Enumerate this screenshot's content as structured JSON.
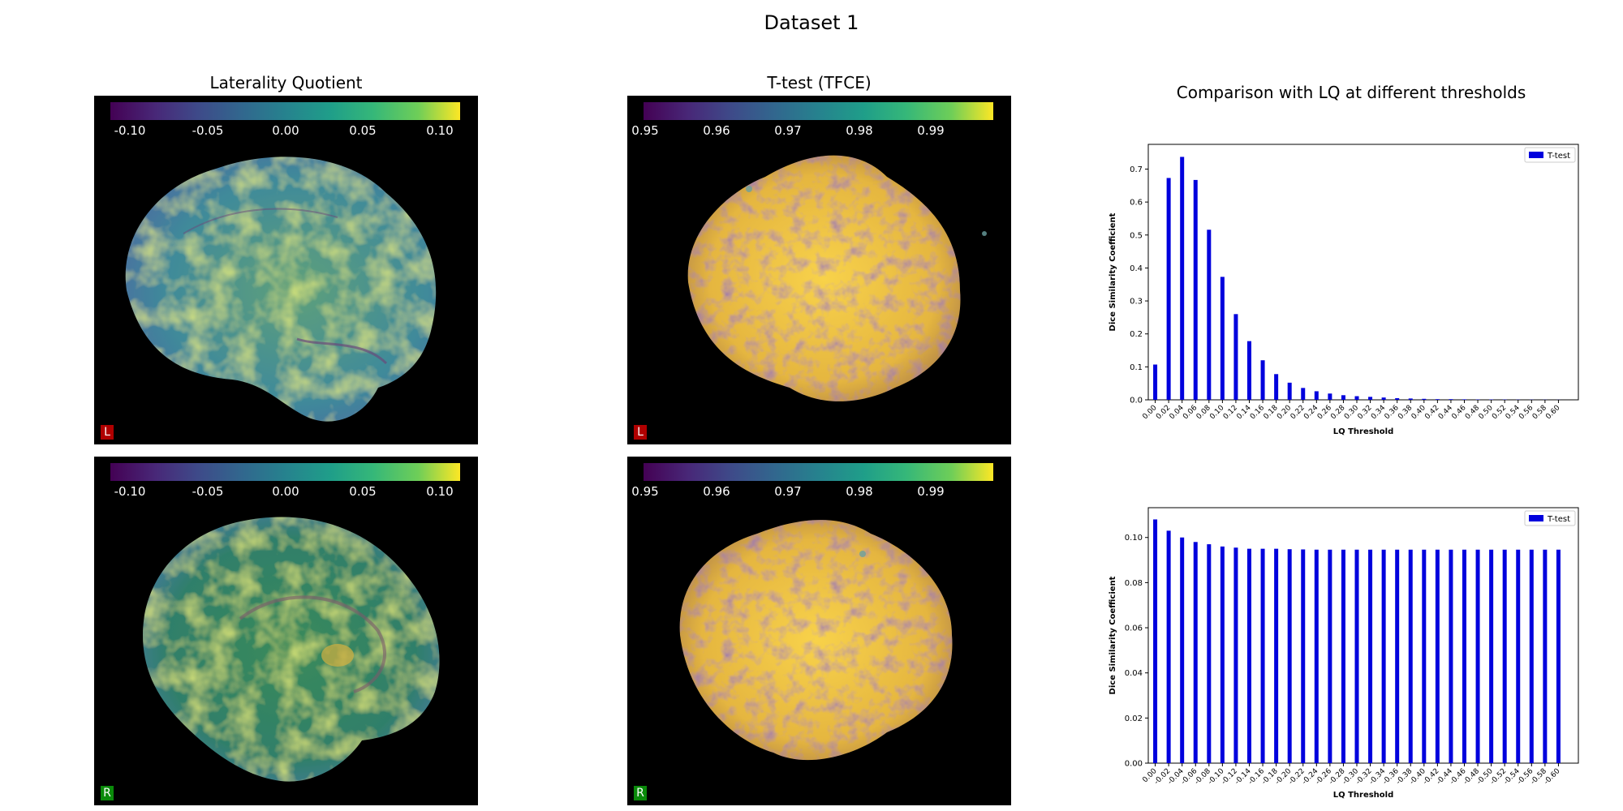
{
  "suptitle": "Dataset 1",
  "columns": {
    "lq_title": "Laterality Quotient",
    "ttest_title": "T-test (TFCE)",
    "compare_title": "Comparison with LQ at different thresholds"
  },
  "colorbars": {
    "lq": {
      "ticks": [
        "-0.10",
        "-0.05",
        "0.00",
        "0.05",
        "0.10"
      ],
      "colormap": "viridis"
    },
    "ttest": {
      "ticks": [
        "0.95",
        "0.96",
        "0.97",
        "0.98",
        "0.99"
      ],
      "colormap": "viridis"
    }
  },
  "brain_views": [
    {
      "row": "left-lateral",
      "hemisphere_label": "L",
      "badge_color": "#b00000"
    },
    {
      "row": "right-medial",
      "hemisphere_label": "R",
      "badge_color": "#0a8a0a"
    }
  ],
  "chart_data": [
    {
      "type": "bar",
      "title": "",
      "xlabel": "LQ Threshold",
      "ylabel": "Dice Similarity Coefficient",
      "categories": [
        "0.00",
        "0.02",
        "0.04",
        "0.06",
        "0.08",
        "0.10",
        "0.12",
        "0.14",
        "0.16",
        "0.18",
        "0.20",
        "0.22",
        "0.24",
        "0.26",
        "0.28",
        "0.30",
        "0.32",
        "0.34",
        "0.36",
        "0.38",
        "0.40",
        "0.42",
        "0.44",
        "0.46",
        "0.48",
        "0.50",
        "0.52",
        "0.54",
        "0.56",
        "0.58",
        "0.60"
      ],
      "series": [
        {
          "name": "T-test",
          "color": "#0000dd",
          "values": [
            0.107,
            0.673,
            0.737,
            0.667,
            0.516,
            0.373,
            0.26,
            0.178,
            0.12,
            0.078,
            0.052,
            0.036,
            0.026,
            0.019,
            0.014,
            0.011,
            0.009,
            0.007,
            0.005,
            0.004,
            0.003,
            0.002,
            0.002,
            0.0015,
            0.001,
            0.001,
            0.0008,
            0.0006,
            0.0005,
            0.0004,
            0.0003
          ]
        }
      ],
      "ylim": [
        0,
        0.775
      ],
      "yticks": [
        "0.0",
        "0.1",
        "0.2",
        "0.3",
        "0.4",
        "0.5",
        "0.6",
        "0.7"
      ],
      "legend": "top-right",
      "grid": false
    },
    {
      "type": "bar",
      "title": "",
      "xlabel": "LQ Threshold",
      "ylabel": "Dice Similarity Coefficient",
      "categories": [
        "0.00",
        "-0.02",
        "-0.04",
        "-0.06",
        "-0.08",
        "-0.10",
        "-0.12",
        "-0.14",
        "-0.16",
        "-0.18",
        "-0.20",
        "-0.22",
        "-0.24",
        "-0.26",
        "-0.28",
        "-0.30",
        "-0.32",
        "-0.34",
        "-0.36",
        "-0.38",
        "-0.40",
        "-0.42",
        "-0.44",
        "-0.46",
        "-0.48",
        "-0.50",
        "-0.52",
        "-0.54",
        "-0.56",
        "-0.58",
        "-0.60"
      ],
      "series": [
        {
          "name": "T-test",
          "color": "#0000dd",
          "values": [
            0.108,
            0.103,
            0.1,
            0.098,
            0.097,
            0.096,
            0.0955,
            0.095,
            0.095,
            0.095,
            0.0948,
            0.0947,
            0.0946,
            0.0946,
            0.0946,
            0.0946,
            0.0946,
            0.0946,
            0.0946,
            0.0946,
            0.0946,
            0.0946,
            0.0946,
            0.0946,
            0.0946,
            0.0946,
            0.0946,
            0.0946,
            0.0946,
            0.0946,
            0.0946
          ]
        }
      ],
      "ylim": [
        0,
        0.1132
      ],
      "yticks": [
        "0.00",
        "0.02",
        "0.04",
        "0.06",
        "0.08",
        "0.10"
      ],
      "legend": "top-right",
      "grid": false
    }
  ]
}
